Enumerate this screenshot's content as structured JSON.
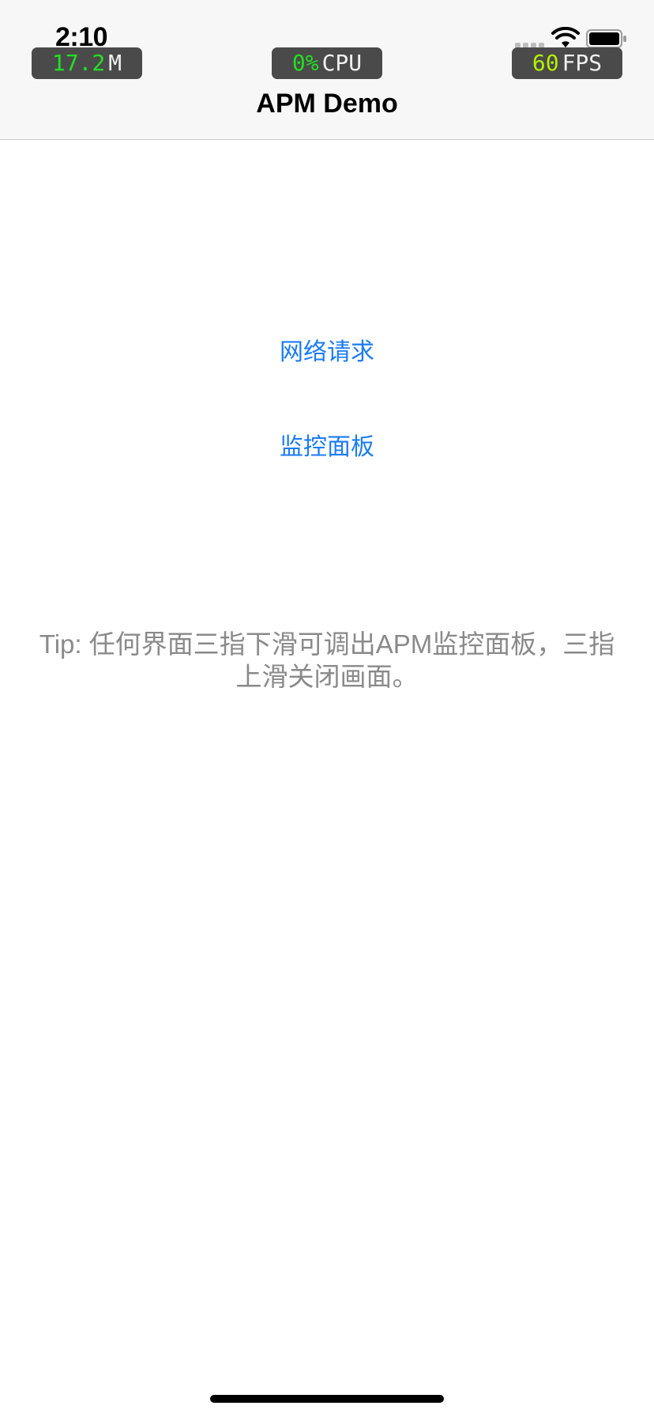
{
  "status_bar": {
    "time": "2:10"
  },
  "perf_overlay": {
    "memory": {
      "value": "17.2",
      "unit": "M"
    },
    "cpu": {
      "value": "0%",
      "unit": "CPU"
    },
    "fps": {
      "value": "60",
      "unit": "FPS"
    }
  },
  "nav": {
    "title": "APM Demo"
  },
  "main": {
    "buttons": [
      {
        "label": "网络请求"
      },
      {
        "label": "监控面板"
      }
    ],
    "tip": "Tip: 任何界面三指下滑可调出APM监控面板，三指上滑关闭画面。"
  },
  "colors": {
    "link": "#1a7cf3",
    "tip_text": "#8a8a8a",
    "badge_bg": "#4a4a4a",
    "badge_value_green": "#22e022",
    "badge_value_fps": "#b4f000"
  },
  "icons": [
    "wifi-icon",
    "battery-icon",
    "signal-icon"
  ]
}
